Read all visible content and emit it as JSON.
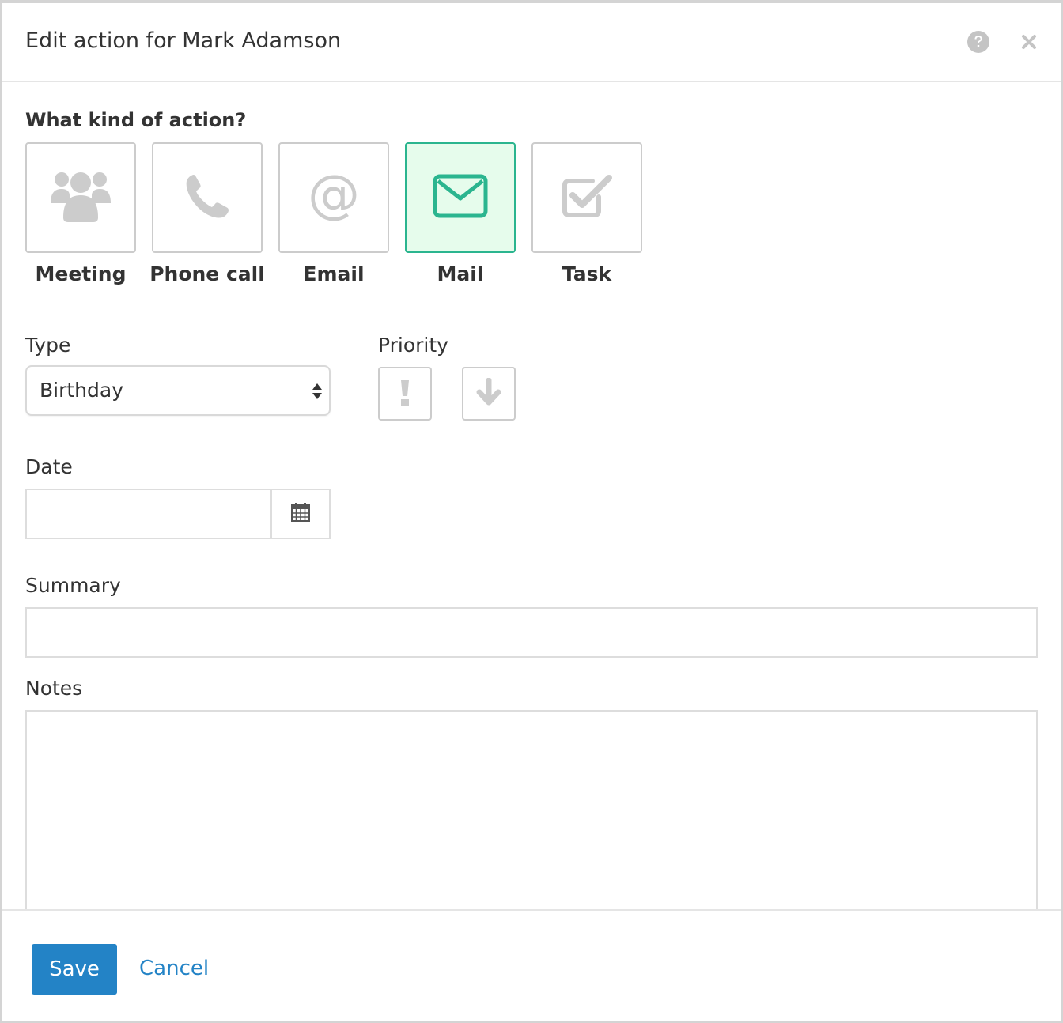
{
  "dialog": {
    "title": "Edit action for Mark Adamson",
    "help_icon": "question-circle-icon",
    "close_icon": "close-icon"
  },
  "action_kind": {
    "question": "What kind of action?",
    "selected": "Mail",
    "options": [
      {
        "label": "Meeting",
        "icon": "users-icon"
      },
      {
        "label": "Phone call",
        "icon": "phone-icon"
      },
      {
        "label": "Email",
        "icon": "at-icon"
      },
      {
        "label": "Mail",
        "icon": "envelope-icon"
      },
      {
        "label": "Task",
        "icon": "checkbox-icon"
      }
    ]
  },
  "form": {
    "type_label": "Type",
    "type_value": "Birthday",
    "priority_label": "Priority",
    "priority_buttons": [
      {
        "icon": "exclamation-icon"
      },
      {
        "icon": "arrow-down-icon"
      }
    ],
    "date_label": "Date",
    "date_value": "",
    "date_icon": "calendar-icon",
    "summary_label": "Summary",
    "summary_value": "",
    "notes_label": "Notes",
    "notes_value": ""
  },
  "footer": {
    "save_label": "Save",
    "cancel_label": "Cancel"
  },
  "colors": {
    "accent": "#2bb58f",
    "selected_bg": "#e6fcec",
    "primary": "#2383c6",
    "icon_gray": "#cccccc"
  }
}
